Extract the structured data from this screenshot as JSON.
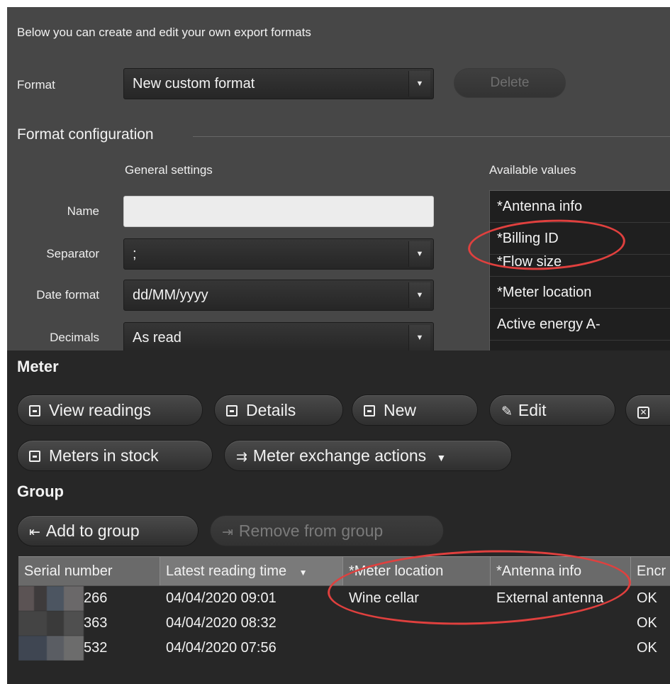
{
  "intro": "Below you can create and edit your own export formats",
  "format": {
    "label": "Format",
    "value": "New custom format",
    "delete_label": "Delete"
  },
  "config": {
    "title": "Format configuration",
    "general_settings": "General settings",
    "available_values": "Available values",
    "name_label": "Name",
    "name_value": "",
    "separator_label": "Separator",
    "separator_value": ";",
    "date_format_label": "Date format",
    "date_format_value": "dd/MM/yyyy",
    "decimals_label": "Decimals",
    "decimals_value": "As read",
    "values": [
      "*Antenna info",
      "*Billing ID",
      "*Flow size",
      "*Meter location",
      "Active energy A-"
    ]
  },
  "meter": {
    "title": "Meter",
    "view_readings": "View readings",
    "details": "Details",
    "new": "New",
    "edit": "Edit",
    "meters_in_stock": "Meters in stock",
    "exchange_actions": "Meter exchange actions"
  },
  "group": {
    "title": "Group",
    "add": "Add to group",
    "remove": "Remove from group"
  },
  "table": {
    "headers": [
      "Serial number",
      "Latest reading time",
      "*Meter location",
      "*Antenna info",
      "Encr"
    ],
    "rows": [
      {
        "serial": "266",
        "time": "04/04/2020 09:01",
        "location": "Wine cellar",
        "antenna": "External antenna",
        "status": "OK"
      },
      {
        "serial": "363",
        "time": "04/04/2020 08:32",
        "location": "",
        "antenna": "",
        "status": "OK"
      },
      {
        "serial": "532",
        "time": "04/04/2020 07:56",
        "location": "",
        "antenna": "",
        "status": "OK"
      }
    ]
  },
  "colors": {
    "annotation": "#e0403e",
    "panel_top": "#474747",
    "panel_bottom": "#272727"
  },
  "icons": [
    "chevron-down-icon",
    "pencil-icon",
    "close-box-icon",
    "save-icon",
    "exchange-icon",
    "add-group-icon",
    "remove-group-icon",
    "sort-down-icon"
  ]
}
